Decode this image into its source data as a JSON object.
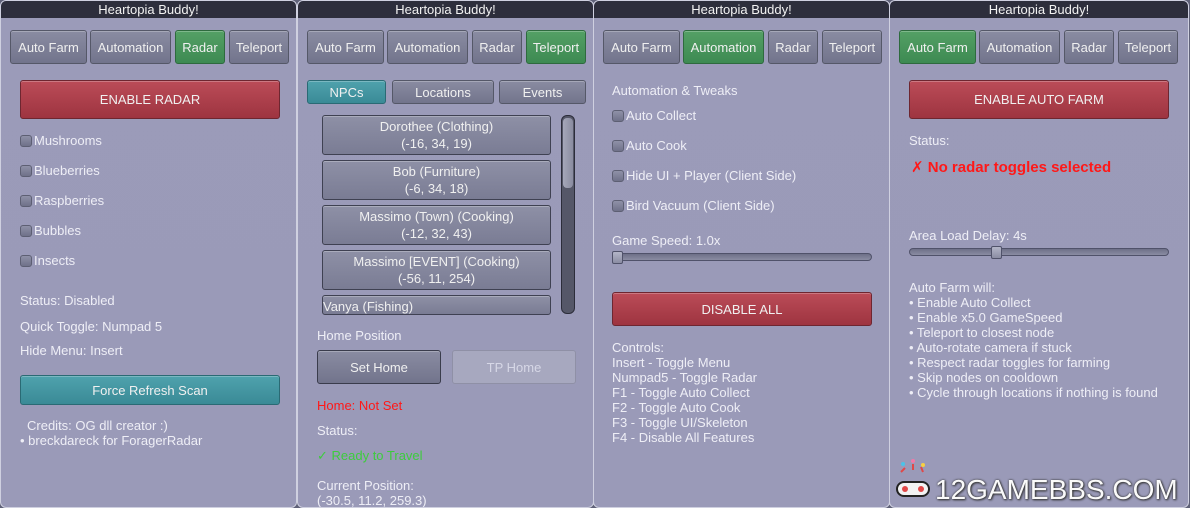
{
  "app_title": "Heartopia Buddy!",
  "tabs": [
    "Auto Farm",
    "Automation",
    "Radar",
    "Teleport"
  ],
  "radar": {
    "enable_label": "ENABLE RADAR",
    "toggles": [
      "Mushrooms",
      "Blueberries",
      "Raspberries",
      "Bubbles",
      "Insects"
    ],
    "status": "Status: Disabled",
    "quick_toggle": "Quick Toggle: Numpad 5",
    "hide_menu": "Hide Menu: Insert",
    "refresh_label": "Force Refresh Scan",
    "credits_1": "Credits: OG dll creator :)",
    "credits_2": "• breckdareck for ForagerRadar"
  },
  "teleport": {
    "subtabs": [
      "NPCs",
      "Locations",
      "Events"
    ],
    "npcs": [
      {
        "name": "Dorothee (Clothing)",
        "pos": "(-16, 34, 19)"
      },
      {
        "name": "Bob (Furniture)",
        "pos": "(-6, 34, 18)"
      },
      {
        "name": "Massimo (Town) (Cooking)",
        "pos": "(-12, 32, 43)"
      },
      {
        "name": "Massimo [EVENT] (Cooking)",
        "pos": "(-56, 11, 254)"
      },
      {
        "name": "Vanya (Fishing)",
        "pos": ""
      }
    ],
    "home_position_label": "Home Position",
    "set_home_label": "Set Home",
    "tp_home_label": "TP Home",
    "home_status": "Home: Not Set",
    "status_label": "Status:",
    "status_value": "✓ Ready to Travel",
    "current_position_label": "Current Position:",
    "current_position_value": "(-30.5, 11.2, 259.3)"
  },
  "automation": {
    "heading": "Automation & Tweaks",
    "toggles": [
      "Auto Collect",
      "Auto Cook",
      "Hide UI + Player (Client Side)",
      "Bird Vacuum (Client Side)"
    ],
    "game_speed_label": "Game Speed: 1.0x",
    "game_speed_fraction": 0.0,
    "disable_all_label": "DISABLE ALL",
    "controls": [
      "Controls:",
      "Insert - Toggle Menu",
      "Numpad5 - Toggle Radar",
      "F1 - Toggle Auto Collect",
      "F2 - Toggle Auto Cook",
      "F3 - Toggle UI/Skeleton",
      "F4 - Disable All Features"
    ]
  },
  "autofarm": {
    "enable_label": "ENABLE AUTO FARM",
    "status_label": "Status:",
    "status_value": "✗ No radar toggles selected",
    "area_delay_label": "Area Load Delay: 4s",
    "area_delay_fraction": 0.33,
    "will_list": [
      "Auto Farm will:",
      "• Enable Auto Collect",
      "• Enable x5.0 GameSpeed",
      "• Teleport to closest node",
      "• Auto-rotate camera if stuck",
      "• Respect radar toggles for farming",
      "• Skip nodes on cooldown",
      "• Cycle through locations if nothing is found"
    ]
  },
  "watermark": "12GAMEBBS.COM",
  "colors": {
    "active_tab": "#47945a",
    "danger": "#a83c48",
    "teal": "#4396a1",
    "error_text": "#ff1818",
    "ok_text": "#3dcc3d"
  }
}
